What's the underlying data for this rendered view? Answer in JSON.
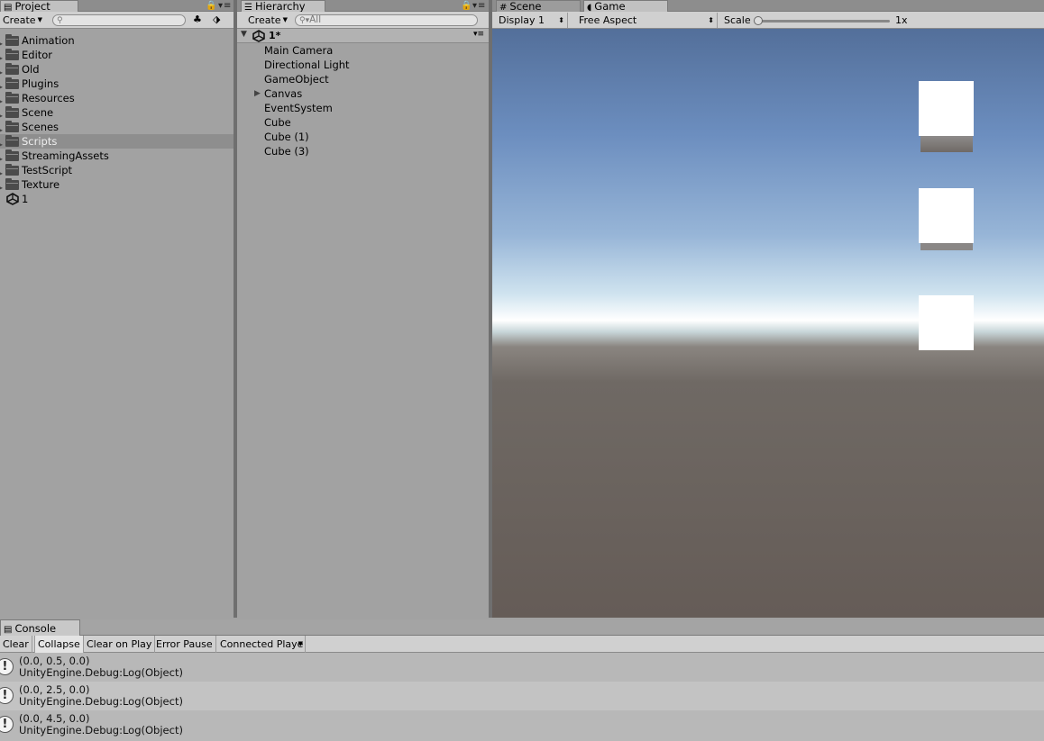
{
  "project": {
    "tab": "Project",
    "create_label": "Create",
    "search_placeholder": "",
    "items": [
      {
        "label": "Animation",
        "type": "folder"
      },
      {
        "label": "Editor",
        "type": "folder"
      },
      {
        "label": "Old",
        "type": "folder"
      },
      {
        "label": "Plugins",
        "type": "folder"
      },
      {
        "label": "Resources",
        "type": "folder"
      },
      {
        "label": "Scene",
        "type": "folder"
      },
      {
        "label": "Scenes",
        "type": "folder"
      },
      {
        "label": "Scripts",
        "type": "folder",
        "selected": true
      },
      {
        "label": "StreamingAssets",
        "type": "folder"
      },
      {
        "label": "TestScript",
        "type": "folder"
      },
      {
        "label": "Texture",
        "type": "folder"
      },
      {
        "label": "1",
        "type": "scene"
      }
    ]
  },
  "hierarchy": {
    "tab": "Hierarchy",
    "create_label": "Create",
    "search_placeholder": "All",
    "scene_name": "1*",
    "items": [
      {
        "label": "Main Camera"
      },
      {
        "label": "Directional Light"
      },
      {
        "label": "GameObject"
      },
      {
        "label": "Canvas",
        "expandable": true
      },
      {
        "label": "EventSystem"
      },
      {
        "label": "Cube"
      },
      {
        "label": "Cube (1)"
      },
      {
        "label": "Cube (3)"
      }
    ]
  },
  "game": {
    "tabs": [
      {
        "label": "Scene",
        "icon": "grid-icon",
        "active": false
      },
      {
        "label": "Game",
        "icon": "pacman-icon",
        "active": true
      }
    ],
    "display": "Display 1",
    "aspect": "Free Aspect",
    "scale_label": "Scale",
    "scale_value": "1x",
    "scale_fraction": 0.0
  },
  "console": {
    "tab": "Console",
    "buttons": {
      "clear": "Clear",
      "collapse": "Collapse",
      "clear_on_play": "Clear on Play",
      "error_pause": "Error Pause",
      "connected_player": "Connected Playe"
    },
    "logs": [
      {
        "line1": "(0.0, 0.5, 0.0)",
        "line2": "UnityEngine.Debug:Log(Object)"
      },
      {
        "line1": "(0.0, 2.5, 0.0)",
        "line2": "UnityEngine.Debug:Log(Object)"
      },
      {
        "line1": "(0.0, 4.5, 0.0)",
        "line2": "UnityEngine.Debug:Log(Object)"
      }
    ]
  },
  "colors": {
    "panel_bg": "#a2a2a2",
    "selection": "#8e8e8e",
    "ground": "#655c57",
    "sky_top": "#536f9a"
  }
}
